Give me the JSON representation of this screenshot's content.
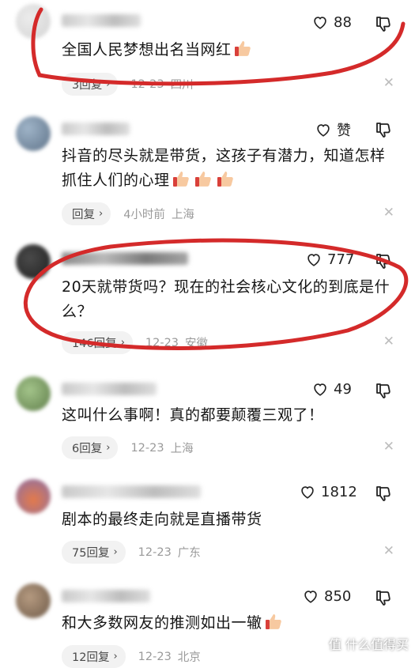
{
  "comments": [
    {
      "likes": "88",
      "text": "全国人民梦想出名当网红",
      "thumbs": 1,
      "replies": "3回复",
      "time": "12-23",
      "location": "四川"
    },
    {
      "likes": "赞",
      "text": "抖音的尽头就是带货，这孩子有潜力，知道怎样抓住人们的心理",
      "thumbs": 3,
      "replies": "回复",
      "time": "4小时前",
      "location": "上海"
    },
    {
      "likes": "777",
      "text": "20天就带货吗？现在的社会核心文化的到底是什么？",
      "thumbs": 0,
      "replies": "146回复",
      "time": "12-23",
      "location": "安徽"
    },
    {
      "likes": "49",
      "text": "这叫什么事啊！真的都要颠覆三观了！",
      "thumbs": 0,
      "replies": "6回复",
      "time": "12-23",
      "location": "上海"
    },
    {
      "likes": "1812",
      "text": "剧本的最终走向就是直播带货",
      "thumbs": 0,
      "replies": "75回复",
      "time": "12-23",
      "location": "广东"
    },
    {
      "likes": "850",
      "text": "和大多数网友的推测如出一辙",
      "thumbs": 1,
      "replies": "12回复",
      "time": "12-23",
      "location": "北京"
    }
  ],
  "icons": {
    "like": "heart-outline-icon",
    "dislike": "thumbs-down-icon",
    "close": "close-icon",
    "thumb": "thumbs-up-emoji"
  },
  "watermark": {
    "text": "值 什么值得买"
  },
  "colors": {
    "annotation": "#d42a2a",
    "meta": "#9a9a9a",
    "pill_bg": "#f2f2f2"
  }
}
